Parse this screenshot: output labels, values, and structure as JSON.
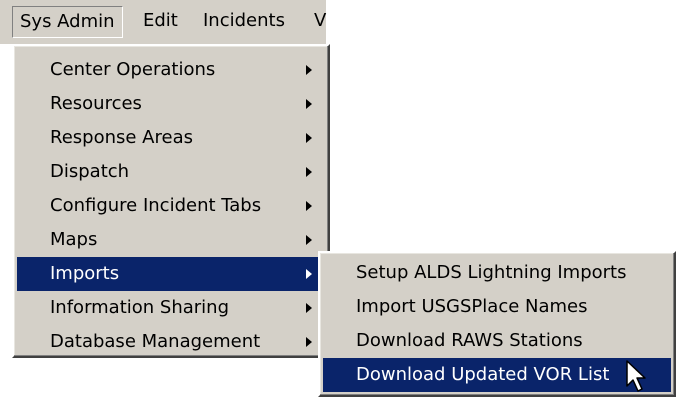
{
  "menubar": {
    "items": [
      {
        "label": "Sys Admin"
      },
      {
        "label": "Edit"
      },
      {
        "label": "Incidents"
      },
      {
        "label": "V"
      }
    ]
  },
  "sysadmin_menu": {
    "items": [
      {
        "label": "Center Operations"
      },
      {
        "label": "Resources"
      },
      {
        "label": "Response Areas"
      },
      {
        "label": "Dispatch"
      },
      {
        "label": "Configure Incident Tabs"
      },
      {
        "label": "Maps"
      },
      {
        "label": "Imports"
      },
      {
        "label": "Information Sharing"
      },
      {
        "label": "Database Management"
      }
    ],
    "selected": "Imports"
  },
  "imports_submenu": {
    "items": [
      {
        "label": "Setup ALDS Lightning Imports"
      },
      {
        "label": "Import USGSPlace Names"
      },
      {
        "label": "Download RAWS Stations"
      },
      {
        "label": "Download Updated VOR List"
      }
    ],
    "selected": "Download Updated VOR List"
  },
  "colors": {
    "menu_face": "#d4d0c8",
    "highlight": "#0a246a",
    "highlight_text": "#ffffff"
  }
}
